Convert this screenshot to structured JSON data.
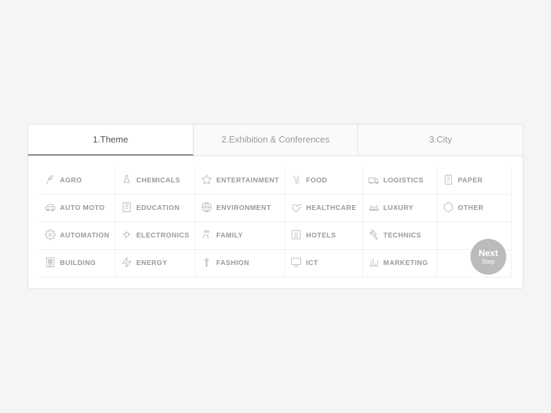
{
  "tabs": [
    {
      "label": "1.Theme",
      "active": true
    },
    {
      "label": "2.Exhibition & Conferences",
      "active": false
    },
    {
      "label": "3.City",
      "active": false
    }
  ],
  "next_button": {
    "line1": "Next",
    "line2": "Step"
  },
  "categories": [
    {
      "id": "agro",
      "label": "AGRO",
      "icon": "leaf"
    },
    {
      "id": "chemicals",
      "label": "CHEMICALS",
      "icon": "flask"
    },
    {
      "id": "entertainment",
      "label": "ENTERTAINMENT",
      "icon": "star"
    },
    {
      "id": "food",
      "label": "FOOD",
      "icon": "fork"
    },
    {
      "id": "logistics",
      "label": "LOGISTICS",
      "icon": "truck"
    },
    {
      "id": "paper",
      "label": "PAPER",
      "icon": "paper"
    },
    {
      "id": "auto-moto",
      "label": "AUTO MOTO",
      "icon": "car"
    },
    {
      "id": "education",
      "label": "EDUCATION",
      "icon": "book"
    },
    {
      "id": "environment",
      "label": "ENVIRONMENT",
      "icon": "globe"
    },
    {
      "id": "healthcare",
      "label": "HEALTHCARE",
      "icon": "heart"
    },
    {
      "id": "luxury",
      "label": "LUXURY",
      "icon": "crown"
    },
    {
      "id": "other",
      "label": "OTHER",
      "icon": "tag"
    },
    {
      "id": "automation",
      "label": "AUTOMATION",
      "icon": "gear"
    },
    {
      "id": "electronics",
      "label": "ELECTRONICS",
      "icon": "circuit"
    },
    {
      "id": "family",
      "label": "FAMILY",
      "icon": "family"
    },
    {
      "id": "hotels",
      "label": "HOTELS",
      "icon": "hotel"
    },
    {
      "id": "technics",
      "label": "TECHNICS",
      "icon": "wrench"
    },
    {
      "id": "placeholder1",
      "label": "",
      "icon": ""
    },
    {
      "id": "building",
      "label": "BUILDING",
      "icon": "building"
    },
    {
      "id": "energy",
      "label": "ENERGY",
      "icon": "energy"
    },
    {
      "id": "fashion",
      "label": "FASHION",
      "icon": "fashion"
    },
    {
      "id": "ict",
      "label": "ICT",
      "icon": "monitor"
    },
    {
      "id": "marketing",
      "label": "MARKETING",
      "icon": "chart"
    },
    {
      "id": "placeholder2",
      "label": "",
      "icon": ""
    }
  ]
}
